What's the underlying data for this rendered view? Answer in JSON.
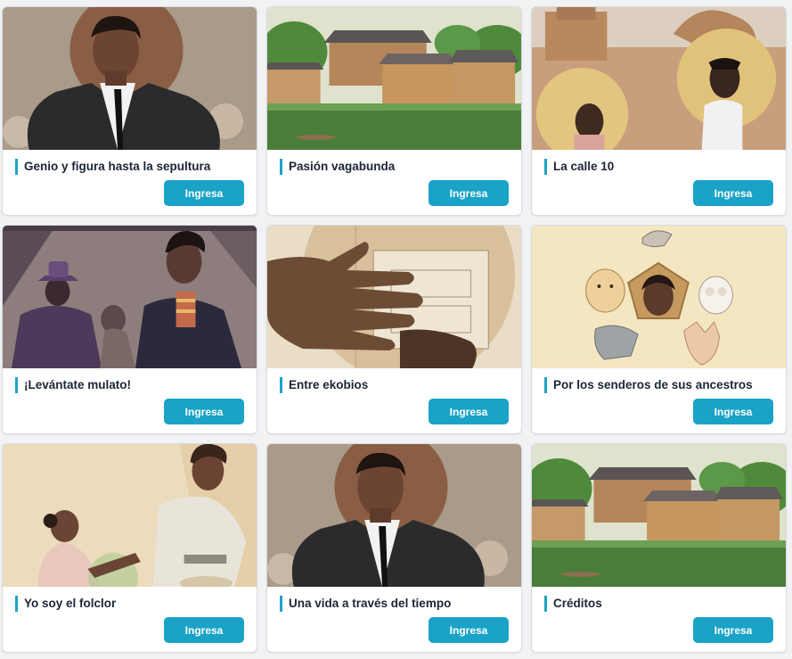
{
  "cards": [
    {
      "title": "Genio y figura hasta la sepultura",
      "button": "Ingresa",
      "illustration": "portrait-man-suit"
    },
    {
      "title": "Pasión vagabunda",
      "button": "Ingresa",
      "illustration": "riverside-houses"
    },
    {
      "title": "La calle 10",
      "button": "Ingresa",
      "illustration": "boys-golden-halos"
    },
    {
      "title": "¡Levántate mulato!",
      "button": "Ingresa",
      "illustration": "men-in-hats"
    },
    {
      "title": "Entre ekobios",
      "button": "Ingresa",
      "illustration": "hand-close-up"
    },
    {
      "title": "Por los senderos de sus ancestros",
      "button": "Ingresa",
      "illustration": "animal-ancestors"
    },
    {
      "title": "Yo soy el folclor",
      "button": "Ingresa",
      "illustration": "couple-dancing"
    },
    {
      "title": "Una vida a través del tiempo",
      "button": "Ingresa",
      "illustration": "portrait-man-suit"
    },
    {
      "title": "Créditos",
      "button": "Ingresa",
      "illustration": "riverside-houses"
    }
  ],
  "colors": {
    "accent": "#1aa3c7",
    "title_text": "#1c2536",
    "page_bg": "#f1f2f4"
  }
}
